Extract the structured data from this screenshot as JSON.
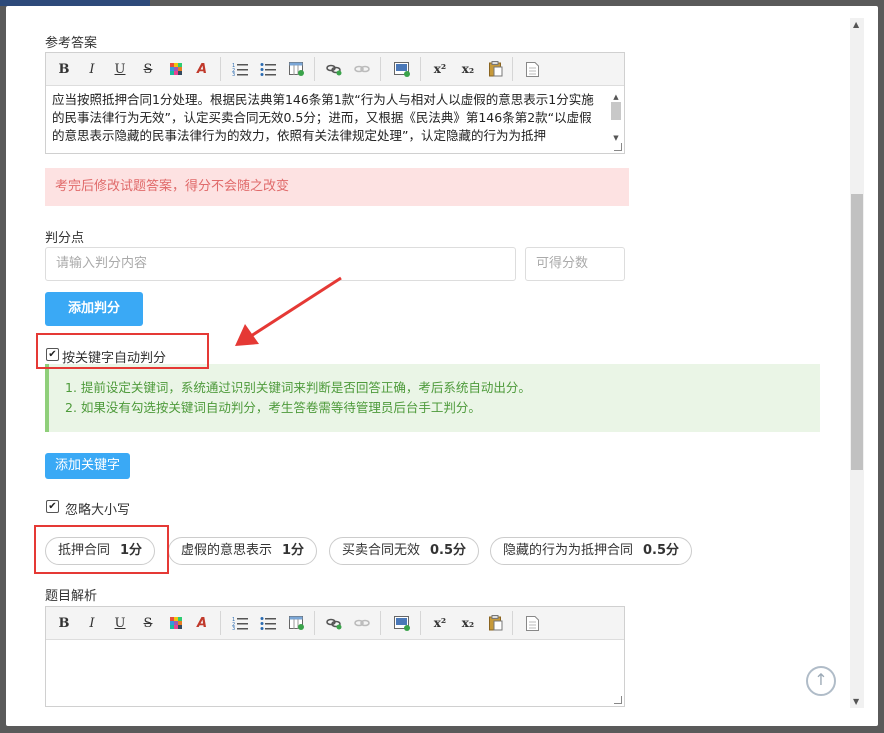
{
  "answer_section": {
    "label": "参考答案",
    "content": "应当按照抵押合同1分处理。根据民法典第146条第1款“行为人与相对人以虚假的意思表示1分实施的民事法律行为无效”，认定买卖合同无效0.5分；进而，又根据《民法典》第146条第2款“以虚假的意思表示隐藏的民事法律行为的效力，依照有关法律规定处理”，认定隐藏的行为为抵押"
  },
  "notice": "考完后修改试题答案，得分不会随之改变",
  "scoring": {
    "label": "判分点",
    "content_placeholder": "请输入判分内容",
    "score_placeholder": "可得分数",
    "add_button": "添加判分"
  },
  "keyword_auto": {
    "label": "按关键字自动判分",
    "checked": true,
    "hint_1": "1. 提前设定关键词，系统通过识别关键词来判断是否回答正确，考后系统自动出分。",
    "hint_2": "2. 如果没有勾选按关键词自动判分，考生答卷需等待管理员后台手工判分。"
  },
  "add_keyword_button": "添加关键字",
  "ignore_case": {
    "label": "忽略大小写",
    "checked": true
  },
  "keywords": [
    {
      "text": "抵押合同",
      "score": "1分"
    },
    {
      "text": "虚假的意思表示",
      "score": "1分"
    },
    {
      "text": "买卖合同无效",
      "score": "0.5分"
    },
    {
      "text": "隐藏的行为为抵押合同",
      "score": "0.5分"
    }
  ],
  "analysis_section": {
    "label": "题目解析"
  },
  "toolbar": {
    "bold": "B",
    "italic": "I",
    "underline": "U",
    "strike": "S",
    "superscript": "x²",
    "subscript": "x₂"
  },
  "colors": {
    "accent": "#3aa9f5",
    "highlight": "#e53935",
    "notice_bg": "#fde2e2",
    "hint_bg": "#eaf5e6"
  },
  "icons": [
    "bold-icon",
    "italic-icon",
    "underline-icon",
    "strikethrough-icon",
    "font-color-icon",
    "clear-format-icon",
    "ordered-list-icon",
    "unordered-list-icon",
    "insert-table-icon",
    "link-icon",
    "unlink-icon",
    "insert-image-icon",
    "superscript-icon",
    "subscript-icon",
    "paste-icon",
    "source-icon",
    "scroll-to-top-icon"
  ]
}
